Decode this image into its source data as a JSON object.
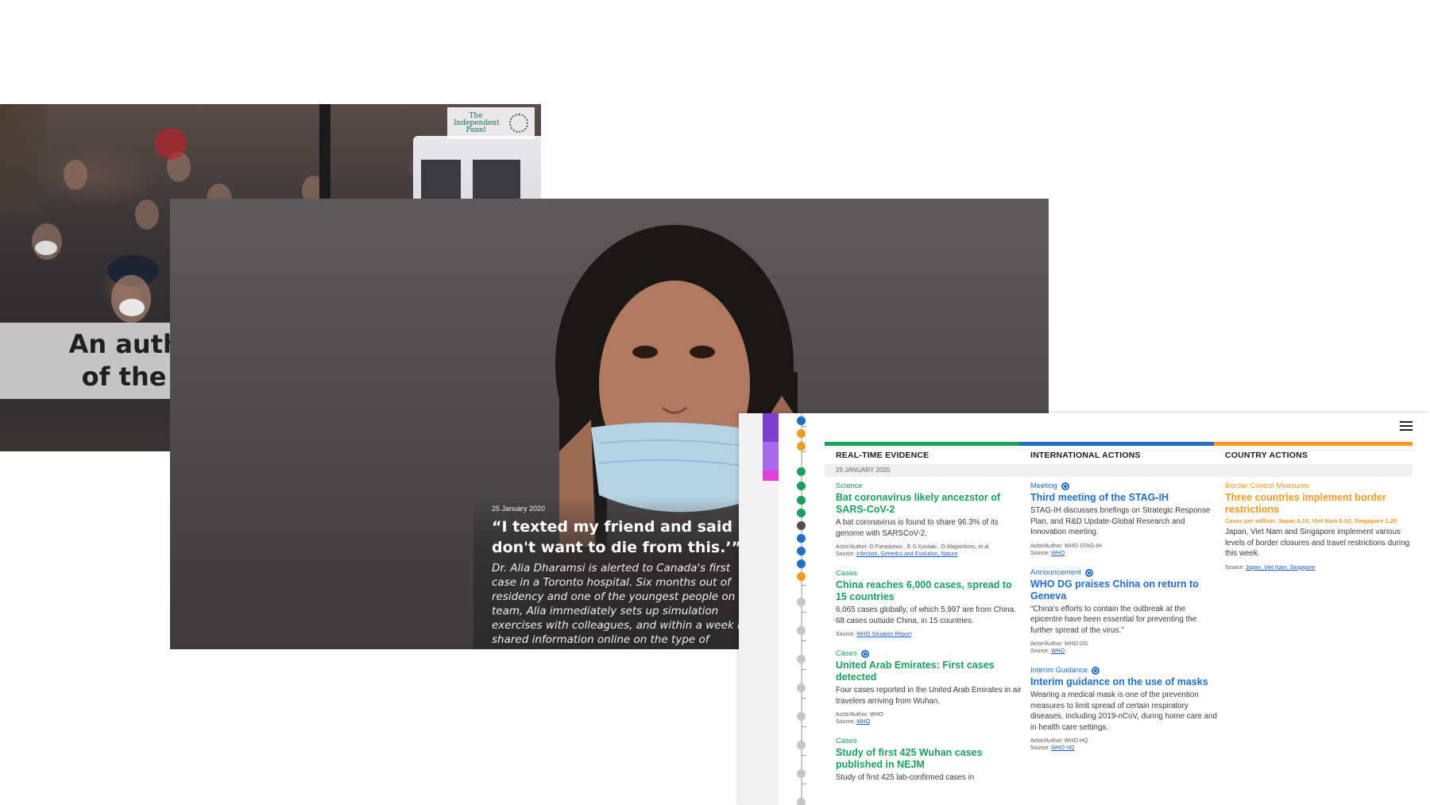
{
  "hero": {
    "title": "An authoritative chronology of the COVID-19 pandemic",
    "logo_text": "The\nIndependent\nPanel",
    "scroll_icon": "chevron-down-icon"
  },
  "story": {
    "date": "25 January 2020",
    "quote": "“I texted my friend and said ‘I don't want to die from this.’”",
    "body": "Dr. Alia Dharamsi is alerted to Canada's first case in a Toronto hospital. Six months out of residency and one of the youngest people on her team, Alia immediately sets up simulation exercises with colleagues, and within a week had shared information online on the type of"
  },
  "timeline": {
    "menu_icon": "hamburger-menu-icon",
    "date_label": "29 JANUARY 2020",
    "colors": {
      "evidence": "#1aa05c",
      "international": "#1f6fc9",
      "country": "#f29a1f",
      "purple": "#7a3fcf",
      "magenta": "#e23ddb",
      "grey_node": "#c5c5c5",
      "dark_node": "#505050"
    },
    "columns": [
      {
        "key": "evidence",
        "header": "REAL-TIME EVIDENCE",
        "entries": [
          {
            "category": "Science",
            "title": "Bat coronavirus likely ancezstor of SARS-CoV-2",
            "desc": "A bat coronavirus is found to share 96.3% of its genome with SARSCoV-2.",
            "actor": "Actor/Author: D Paraskevis , E G Kostaki , G Magiorkinis, et al.",
            "source_label": "Source:",
            "source": "Infection, Genetics and Evolution, Nature"
          },
          {
            "category": "Cases",
            "title": "China reaches 6,000 cases, spread to 15 countries",
            "desc": "6,065 cases globally, of which 5,997 are from China. 68 cases outside China, in 15 countries.",
            "actor": "",
            "source_label": "Source:",
            "source": "WHO Situation Report"
          },
          {
            "category": "Cases",
            "title": "United Arab Emirates: First cases detected",
            "desc": "Four cases reported in the United Arab Emirates in air travelers arriving from Wuhan.",
            "actor": "Actor/Author: WHO",
            "source_label": "Source:",
            "source": "WHO"
          },
          {
            "category": "Cases",
            "title": "Study of first 425 Wuhan cases published in NEJM",
            "desc": "Study of first 425 lab-confirmed cases in",
            "actor": "",
            "source_label": "",
            "source": ""
          }
        ]
      },
      {
        "key": "international",
        "header": "INTERNATIONAL ACTIONS",
        "entries": [
          {
            "category": "Meeting",
            "title": "Third meeting of the STAG-IH",
            "desc": "STAG-IH discusses briefings on Strategic Response Plan, and R&D Update-Global Research and Innovation meeting.",
            "actor": "Actor/Author: WHO STAG-IH",
            "source_label": "Source:",
            "source": "WHO"
          },
          {
            "category": "Announcement",
            "title": "WHO DG praises China on return to Geneva",
            "desc": "“China's efforts to contain the outbreak at the epicentre have been essential for preventing the further spread of the virus.”",
            "actor": "Actor/Author: WHO DG",
            "source_label": "Source:",
            "source": "WHO"
          },
          {
            "category": "Interim Guidance",
            "title": "Interim guidance on the use of masks",
            "desc": "Wearing a medical mask is one of the prevention measures to limit spread of certain respiratory diseases, including 2019-nCoV, during home care and in health care settings.",
            "actor": "Actor/Author: WHO HQ",
            "source_label": "Source:",
            "source": "WHO HQ"
          }
        ]
      },
      {
        "key": "country",
        "header": "COUNTRY ACTIONS",
        "entries": [
          {
            "category": "Border Control Measures",
            "title": "Three countries implement border restrictions",
            "note": "Cases per million: Japan 0.16; Viet Nam 0.02; Singapore 1.20",
            "desc": "Japan, Viet Nam and Singapore implement various levels of border closures and travel restrictions during this week.",
            "actor": "",
            "source_label": "Source:",
            "source": "Japan, Viet Nam, Singapore"
          }
        ]
      }
    ]
  }
}
